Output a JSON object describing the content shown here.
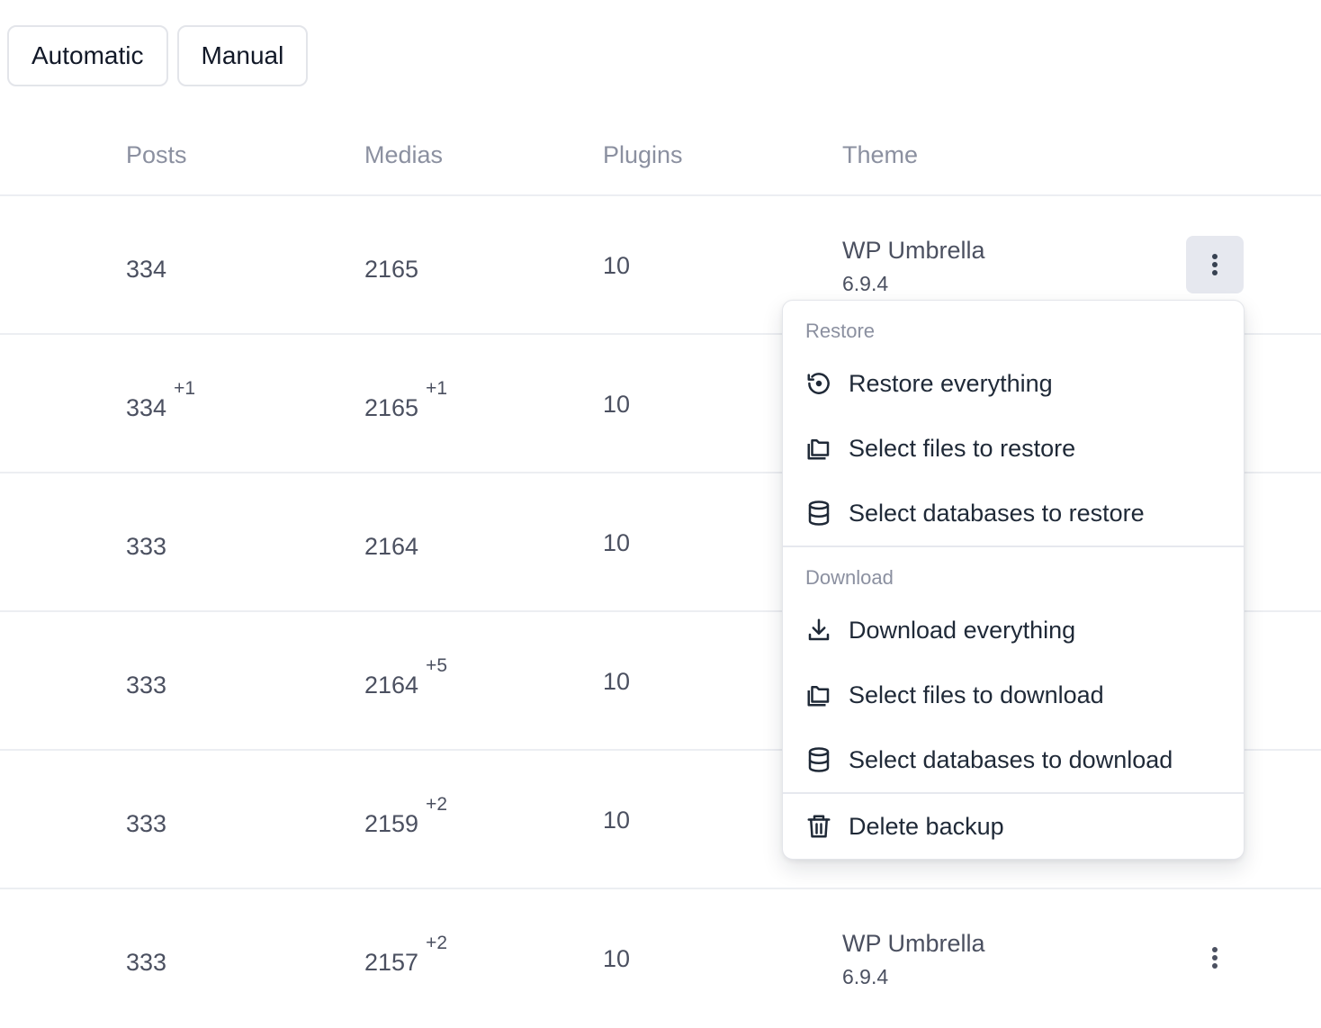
{
  "filters": {
    "automatic": "Automatic",
    "manual": "Manual"
  },
  "columns": {
    "posts": "Posts",
    "medias": "Medias",
    "plugins": "Plugins",
    "theme": "Theme"
  },
  "rows": [
    {
      "posts": "334",
      "posts_delta": "",
      "medias": "2165",
      "medias_delta": "",
      "plugins": "10",
      "theme_name": "WP Umbrella",
      "theme_version": "6.9.4"
    },
    {
      "posts": "334",
      "posts_delta": "+1",
      "medias": "2165",
      "medias_delta": "+1",
      "plugins": "10",
      "theme_name": "",
      "theme_version": ""
    },
    {
      "posts": "333",
      "posts_delta": "",
      "medias": "2164",
      "medias_delta": "",
      "plugins": "10",
      "theme_name": "",
      "theme_version": ""
    },
    {
      "posts": "333",
      "posts_delta": "",
      "medias": "2164",
      "medias_delta": "+5",
      "plugins": "10",
      "theme_name": "",
      "theme_version": ""
    },
    {
      "posts": "333",
      "posts_delta": "",
      "medias": "2159",
      "medias_delta": "+2",
      "plugins": "10",
      "theme_name": "",
      "theme_version": ""
    },
    {
      "posts": "333",
      "posts_delta": "",
      "medias": "2157",
      "medias_delta": "+2",
      "plugins": "10",
      "theme_name": "WP Umbrella",
      "theme_version": "6.9.4"
    }
  ],
  "menu": {
    "restore_heading": "Restore",
    "restore_everything": "Restore everything",
    "restore_files": "Select files to restore",
    "restore_databases": "Select databases to restore",
    "download_heading": "Download",
    "download_everything": "Download everything",
    "download_files": "Select files to download",
    "download_databases": "Select databases to download",
    "delete_backup": "Delete backup"
  },
  "icons": {
    "kebab": "more-vertical-icon",
    "restore": "history-icon",
    "files": "folders-icon",
    "database": "database-icon",
    "download": "download-icon",
    "delete": "trash-icon"
  },
  "colors": {
    "text": "#4b5060",
    "muted": "#8b90a0",
    "menu_text": "#1f2937",
    "active_button": "#e6e8ef",
    "border": "#e3e5ea"
  }
}
